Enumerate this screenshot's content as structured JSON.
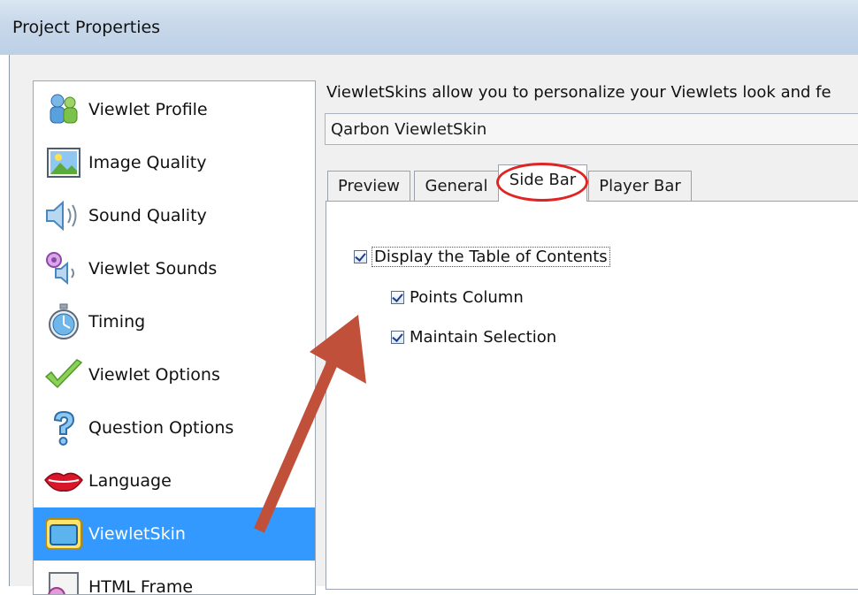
{
  "window": {
    "title": "Project Properties"
  },
  "sidebar": {
    "items": [
      {
        "label": "Viewlet Profile",
        "icon": "profile-users-icon"
      },
      {
        "label": "Image Quality",
        "icon": "image-picture-icon"
      },
      {
        "label": "Sound Quality",
        "icon": "speaker-icon"
      },
      {
        "label": "Viewlet Sounds",
        "icon": "sounds-speaker-icon"
      },
      {
        "label": "Timing",
        "icon": "stopwatch-icon"
      },
      {
        "label": "Viewlet Options",
        "icon": "checkmark-icon"
      },
      {
        "label": "Question Options",
        "icon": "question-mark-icon"
      },
      {
        "label": "Language",
        "icon": "lips-icon"
      },
      {
        "label": "ViewletSkin",
        "icon": "window-skin-icon",
        "selected": true
      },
      {
        "label": "HTML Frame",
        "icon": "html-frame-icon"
      }
    ]
  },
  "main": {
    "description": "ViewletSkins allow you to personalize your Viewlets look and fe",
    "skin_select": {
      "value": "Qarbon ViewletSkin"
    },
    "tabs": [
      {
        "label": "Preview"
      },
      {
        "label": "General"
      },
      {
        "label": "Side Bar",
        "active": true
      },
      {
        "label": "Player Bar"
      }
    ],
    "options": {
      "display_toc": {
        "label": "Display the Table of Contents",
        "checked": true
      },
      "points_column": {
        "label": "Points Column",
        "checked": true
      },
      "maintain_selection": {
        "label": "Maintain Selection",
        "checked": true
      }
    }
  },
  "colors": {
    "selection": "#3399ff",
    "annotation_arrow": "#c0503a",
    "annotation_ring": "#e02424"
  }
}
